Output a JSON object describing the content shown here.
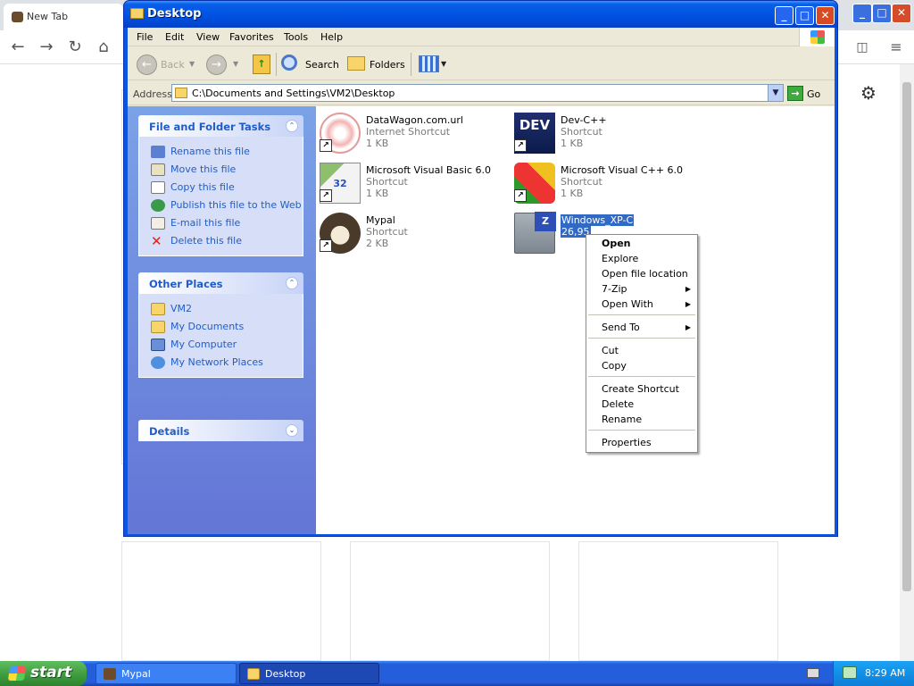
{
  "browser": {
    "tab_title": "New Tab",
    "nav": {
      "back_icon": "←",
      "forward_icon": "→",
      "reload_icon": "↻",
      "home_icon": "⌂"
    },
    "settings_icon": "⚙"
  },
  "window": {
    "title": "Desktop",
    "controls": {
      "minimize": "_",
      "maximize": "□",
      "close": "✕"
    }
  },
  "menubar": [
    "File",
    "Edit",
    "View",
    "Favorites",
    "Tools",
    "Help"
  ],
  "toolbar": {
    "back": "Back",
    "search": "Search",
    "folders": "Folders"
  },
  "address": {
    "label": "Address",
    "value": "C:\\Documents and Settings\\VM2\\Desktop",
    "go": "Go"
  },
  "taskpane": {
    "file_tasks": {
      "title": "File and Folder Tasks",
      "items": [
        "Rename this file",
        "Move this file",
        "Copy this file",
        "Publish this file to the Web",
        "E-mail this file",
        "Delete this file"
      ]
    },
    "other_places": {
      "title": "Other Places",
      "items": [
        "VM2",
        "My Documents",
        "My Computer",
        "My Network Places"
      ]
    },
    "details": {
      "title": "Details"
    }
  },
  "files": [
    {
      "name": "DataWagon.com.url",
      "type": "Internet Shortcut",
      "size": "1 KB"
    },
    {
      "name": "Dev-C++",
      "type": "Shortcut",
      "size": "1 KB"
    },
    {
      "name": "Microsoft Visual Basic 6.0",
      "type": "Shortcut",
      "size": "1 KB"
    },
    {
      "name": "Microsoft Visual C++ 6.0",
      "type": "Shortcut",
      "size": "1 KB"
    },
    {
      "name": "Mypal",
      "type": "Shortcut",
      "size": "2 KB"
    },
    {
      "name": "Windows_XP-C",
      "size": "26,95"
    }
  ],
  "context_menu": {
    "items": [
      "Open",
      "Explore",
      "Open file location",
      "7-Zip",
      "Open With",
      "Send To",
      "Cut",
      "Copy",
      "Create Shortcut",
      "Delete",
      "Rename",
      "Properties"
    ]
  },
  "taskbar": {
    "start": "start",
    "tasks": [
      "Mypal",
      "Desktop"
    ],
    "clock": "8:29 AM"
  },
  "colors": {
    "xp_blue": "#0054e3",
    "taskpane_link": "#215dc6",
    "selection": "#316ac5",
    "start_green": "#3c9a3c"
  }
}
